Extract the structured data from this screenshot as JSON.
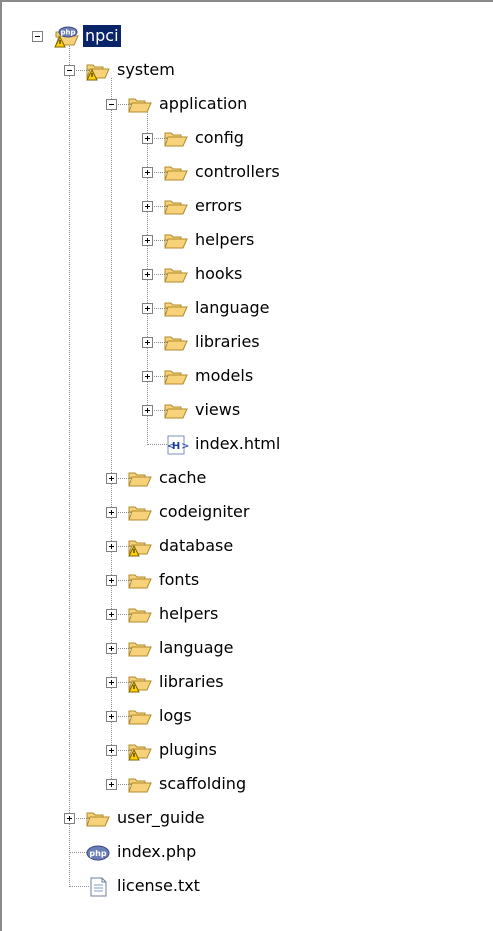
{
  "tree": {
    "nodes": [
      {
        "label": "npci",
        "icon": "php-project-icon",
        "warning": true,
        "expander": "expanded",
        "depth": 0,
        "selected": true
      },
      {
        "label": "system",
        "icon": "folder-icon",
        "warning": true,
        "expander": "expanded",
        "depth": 1
      },
      {
        "label": "application",
        "icon": "folder-icon",
        "warning": false,
        "expander": "expanded",
        "depth": 2
      },
      {
        "label": "config",
        "icon": "folder-icon",
        "warning": false,
        "expander": "collapsed",
        "depth": 3
      },
      {
        "label": "controllers",
        "icon": "folder-icon",
        "warning": false,
        "expander": "collapsed",
        "depth": 3
      },
      {
        "label": "errors",
        "icon": "folder-icon",
        "warning": false,
        "expander": "collapsed",
        "depth": 3
      },
      {
        "label": "helpers",
        "icon": "folder-icon",
        "warning": false,
        "expander": "collapsed",
        "depth": 3
      },
      {
        "label": "hooks",
        "icon": "folder-icon",
        "warning": false,
        "expander": "collapsed",
        "depth": 3
      },
      {
        "label": "language",
        "icon": "folder-icon",
        "warning": false,
        "expander": "collapsed",
        "depth": 3
      },
      {
        "label": "libraries",
        "icon": "folder-icon",
        "warning": false,
        "expander": "collapsed",
        "depth": 3
      },
      {
        "label": "models",
        "icon": "folder-icon",
        "warning": false,
        "expander": "collapsed",
        "depth": 3
      },
      {
        "label": "views",
        "icon": "folder-icon",
        "warning": false,
        "expander": "collapsed",
        "depth": 3
      },
      {
        "label": "index.html",
        "icon": "html-file-icon",
        "warning": false,
        "expander": "none",
        "depth": 3
      },
      {
        "label": "cache",
        "icon": "folder-icon",
        "warning": false,
        "expander": "collapsed",
        "depth": 2
      },
      {
        "label": "codeigniter",
        "icon": "folder-icon",
        "warning": false,
        "expander": "collapsed",
        "depth": 2
      },
      {
        "label": "database",
        "icon": "folder-icon",
        "warning": true,
        "expander": "collapsed",
        "depth": 2
      },
      {
        "label": "fonts",
        "icon": "folder-icon",
        "warning": false,
        "expander": "collapsed",
        "depth": 2
      },
      {
        "label": "helpers",
        "icon": "folder-icon",
        "warning": false,
        "expander": "collapsed",
        "depth": 2
      },
      {
        "label": "language",
        "icon": "folder-icon",
        "warning": false,
        "expander": "collapsed",
        "depth": 2
      },
      {
        "label": "libraries",
        "icon": "folder-icon",
        "warning": true,
        "expander": "collapsed",
        "depth": 2
      },
      {
        "label": "logs",
        "icon": "folder-icon",
        "warning": false,
        "expander": "collapsed",
        "depth": 2
      },
      {
        "label": "plugins",
        "icon": "folder-icon",
        "warning": true,
        "expander": "collapsed",
        "depth": 2
      },
      {
        "label": "scaffolding",
        "icon": "folder-icon",
        "warning": false,
        "expander": "collapsed",
        "depth": 2
      },
      {
        "label": "user_guide",
        "icon": "folder-icon",
        "warning": false,
        "expander": "collapsed",
        "depth": 1
      },
      {
        "label": "index.php",
        "icon": "php-file-icon",
        "warning": false,
        "expander": "none",
        "depth": 1
      },
      {
        "label": "license.txt",
        "icon": "text-file-icon",
        "warning": false,
        "expander": "none",
        "depth": 1
      }
    ]
  },
  "colors": {
    "folder_fill": "#f7d27a",
    "folder_stroke": "#b08a2a",
    "warning_fill": "#ffd200",
    "selection_bg": "#0a246a",
    "php_blue": "#6c7eb7"
  }
}
